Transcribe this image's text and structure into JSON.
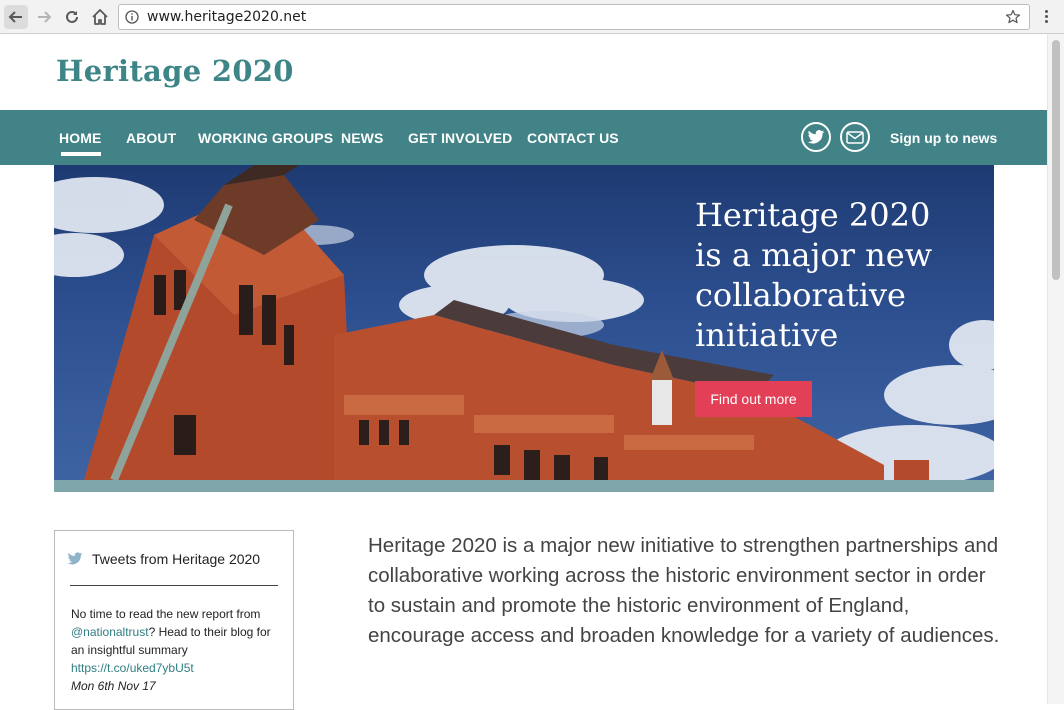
{
  "browser": {
    "url": "www.heritage2020.net"
  },
  "site": {
    "title": "Heritage 2020"
  },
  "nav": {
    "items": [
      {
        "label": "HOME",
        "active": true
      },
      {
        "label": "ABOUT"
      },
      {
        "label": "WORKING GROUPS"
      },
      {
        "label": "NEWS"
      },
      {
        "label": "GET INVOLVED"
      },
      {
        "label": "CONTACT US"
      }
    ],
    "icons": [
      "twitter-icon",
      "mail-icon"
    ],
    "signup_label": "Sign up to news"
  },
  "hero": {
    "heading_lines": [
      "Heritage 2020",
      "is a major new",
      "collaborative",
      "initiative"
    ],
    "cta_label": "Find out more"
  },
  "tweets": {
    "title": "Tweets from Heritage 2020",
    "tweet": {
      "text_1": "No time to read the new report from",
      "mention": "@nationaltrust",
      "text_2": "? Head to their blog for an insightful summary",
      "link": "https://t.co/uked7ybU5t",
      "date": "Mon 6th Nov 17"
    }
  },
  "intro": {
    "text": "Heritage 2020 is a major new initiative to strengthen partnerships and collaborative working across the historic environment sector in order to sustain and promote the historic environment of England, encourage access and broaden knowledge for a variety of audiences."
  },
  "colors": {
    "brand_teal": "#428387",
    "title_teal": "#3d8587",
    "cta_red": "#e33f56"
  }
}
